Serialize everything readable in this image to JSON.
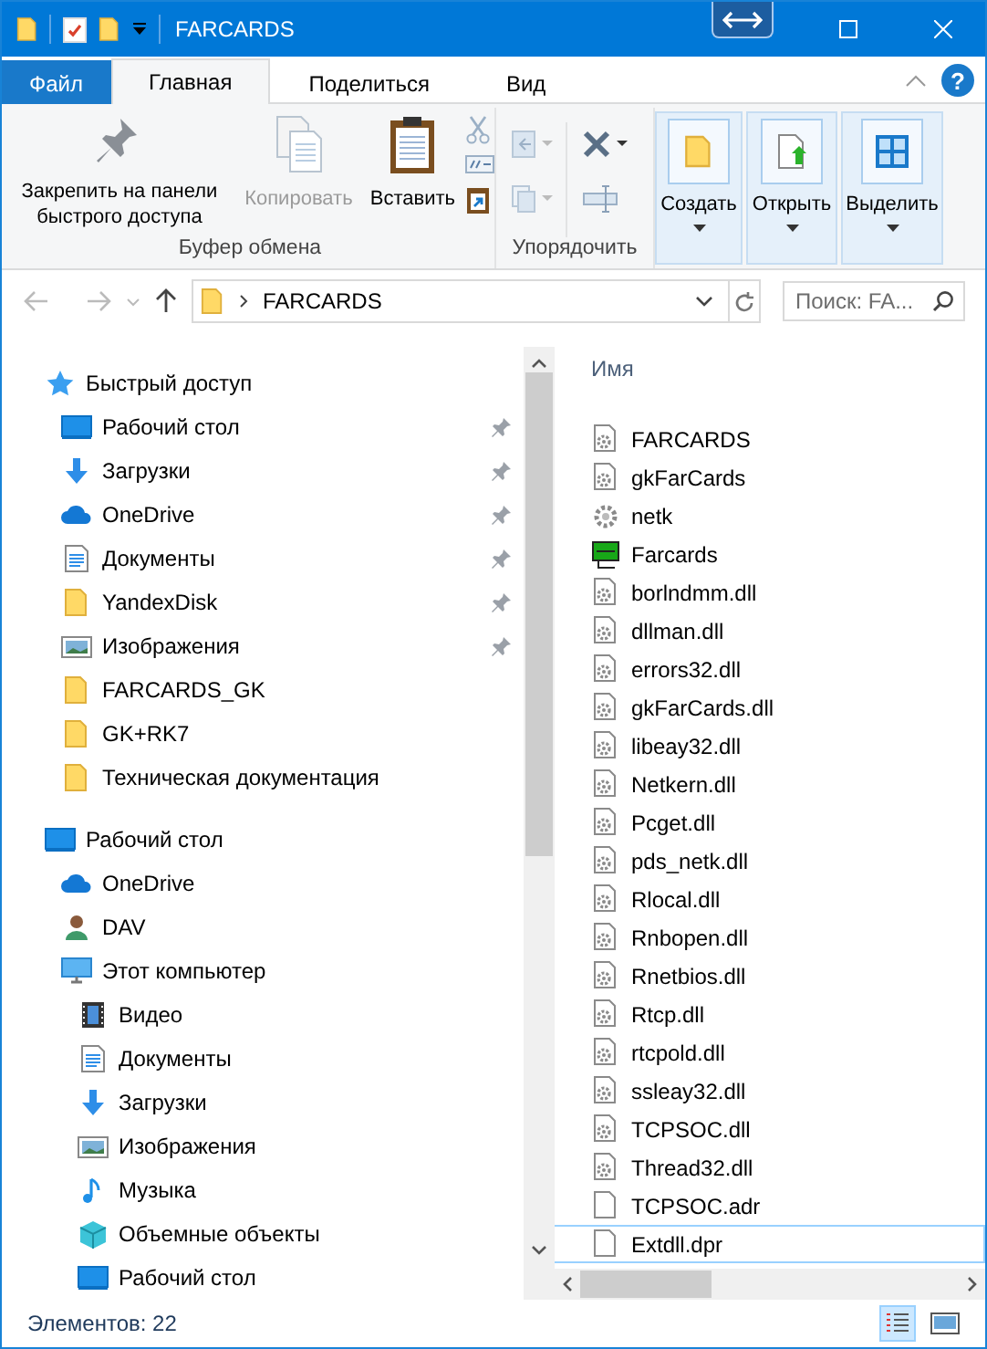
{
  "window": {
    "title": "FARCARDS"
  },
  "tabs": [
    {
      "label": "Файл",
      "kind": "file",
      "selected": false
    },
    {
      "label": "Главная",
      "kind": "normal",
      "selected": true
    },
    {
      "label": "Поделиться",
      "kind": "normal",
      "selected": false
    },
    {
      "label": "Вид",
      "kind": "normal",
      "selected": false
    }
  ],
  "help": {
    "label": "?"
  },
  "ribbon": {
    "clipboard": {
      "label": "Буфер обмена",
      "buttons": [
        {
          "kind": "pin",
          "label": "Закрепить на панели быстрого доступа",
          "disabled": false
        },
        {
          "kind": "copy",
          "label": "Копировать",
          "disabled": true
        },
        {
          "kind": "paste",
          "label": "Вставить",
          "disabled": false
        }
      ]
    },
    "organize": {
      "label": "Упорядочить"
    },
    "big_buttons": [
      {
        "kind": "new",
        "label": "Создать"
      },
      {
        "kind": "open",
        "label": "Открыть"
      },
      {
        "kind": "select",
        "label": "Выделить"
      }
    ]
  },
  "address": {
    "path": "FARCARDS"
  },
  "search": {
    "placeholder": "Поиск: FA..."
  },
  "nav": [
    {
      "label": "Быстрый доступ",
      "kind": "star",
      "pinned": false,
      "children": [
        {
          "label": "Рабочий стол",
          "kind": "desktop",
          "pinned": true
        },
        {
          "label": "Загрузки",
          "kind": "download",
          "pinned": true
        },
        {
          "label": "OneDrive",
          "kind": "cloud",
          "pinned": true
        },
        {
          "label": "Документы",
          "kind": "docs",
          "pinned": true
        },
        {
          "label": "YandexDisk",
          "kind": "folder",
          "pinned": true
        },
        {
          "label": "Изображения",
          "kind": "pictures",
          "pinned": true
        },
        {
          "label": "FARCARDS_GK",
          "kind": "folder",
          "pinned": false
        },
        {
          "label": "GK+RK7",
          "kind": "folder",
          "pinned": false
        },
        {
          "label": "Техническая документация",
          "kind": "folder",
          "pinned": false
        }
      ]
    },
    {
      "label": "Рабочий стол",
      "kind": "desktop",
      "pinned": false,
      "children": [
        {
          "label": "OneDrive",
          "kind": "cloud",
          "pinned": false
        },
        {
          "label": "DAV",
          "kind": "user",
          "pinned": false
        },
        {
          "label": "Этот компьютер",
          "kind": "computer",
          "pinned": false,
          "children": [
            {
              "label": "Видео",
              "kind": "video",
              "pinned": false
            },
            {
              "label": "Документы",
              "kind": "docs",
              "pinned": false
            },
            {
              "label": "Загрузки",
              "kind": "download",
              "pinned": false
            },
            {
              "label": "Изображения",
              "kind": "pictures",
              "pinned": false
            },
            {
              "label": "Музыка",
              "kind": "music",
              "pinned": false
            },
            {
              "label": "Объемные объекты",
              "kind": "cube",
              "pinned": false
            },
            {
              "label": "Рабочий стол",
              "kind": "desktop",
              "pinned": false
            }
          ]
        }
      ]
    }
  ],
  "files": {
    "column": "Имя",
    "items": [
      {
        "name": "FARCARDS",
        "kind": "exe",
        "selected": false
      },
      {
        "name": "gkFarCards",
        "kind": "exe",
        "selected": false
      },
      {
        "name": "netk",
        "kind": "gear",
        "selected": false
      },
      {
        "name": "Farcards",
        "kind": "shortcut",
        "selected": false
      },
      {
        "name": "borlndmm.dll",
        "kind": "dll",
        "selected": false
      },
      {
        "name": "dllman.dll",
        "kind": "dll",
        "selected": false
      },
      {
        "name": "errors32.dll",
        "kind": "dll",
        "selected": false
      },
      {
        "name": "gkFarCards.dll",
        "kind": "dll",
        "selected": false
      },
      {
        "name": "libeay32.dll",
        "kind": "dll",
        "selected": false
      },
      {
        "name": "Netkern.dll",
        "kind": "dll",
        "selected": false
      },
      {
        "name": "Pcget.dll",
        "kind": "dll",
        "selected": false
      },
      {
        "name": "pds_netk.dll",
        "kind": "dll",
        "selected": false
      },
      {
        "name": "Rlocal.dll",
        "kind": "dll",
        "selected": false
      },
      {
        "name": "Rnbopen.dll",
        "kind": "dll",
        "selected": false
      },
      {
        "name": "Rnetbios.dll",
        "kind": "dll",
        "selected": false
      },
      {
        "name": "Rtcp.dll",
        "kind": "dll",
        "selected": false
      },
      {
        "name": "rtcpold.dll",
        "kind": "dll",
        "selected": false
      },
      {
        "name": "ssleay32.dll",
        "kind": "dll",
        "selected": false
      },
      {
        "name": "TCPSOC.dll",
        "kind": "dll",
        "selected": false
      },
      {
        "name": "Thread32.dll",
        "kind": "dll",
        "selected": false
      },
      {
        "name": "TCPSOC.adr",
        "kind": "file",
        "selected": false
      },
      {
        "name": "Extdll.dpr",
        "kind": "file",
        "selected": true
      }
    ]
  },
  "status_bar": {
    "count": "Элементов: 22",
    "views": [
      {
        "kind": "details",
        "selected": true
      },
      {
        "kind": "large",
        "selected": false
      }
    ]
  }
}
